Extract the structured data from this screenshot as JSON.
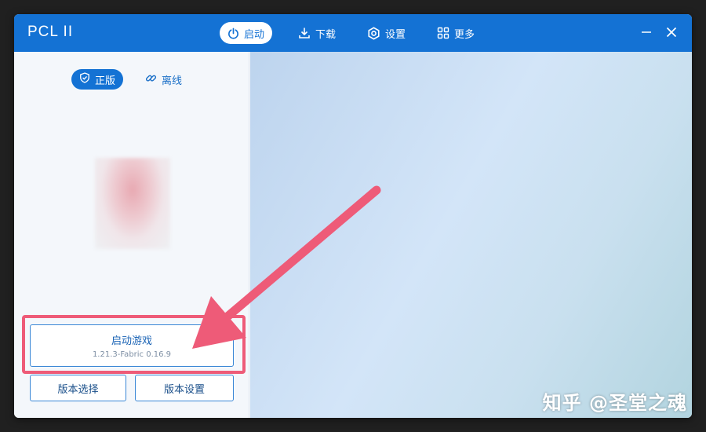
{
  "app": {
    "title": "PCL II"
  },
  "nav": {
    "tabs": [
      {
        "label": "启动",
        "icon": "power-icon",
        "active": true
      },
      {
        "label": "下载",
        "icon": "download-icon",
        "active": false
      },
      {
        "label": "设置",
        "icon": "gear-icon",
        "active": false
      },
      {
        "label": "更多",
        "icon": "grid-icon",
        "active": false
      }
    ]
  },
  "mode": {
    "official": "正版",
    "offline": "离线"
  },
  "launch": {
    "title": "启动游戏",
    "version": "1.21.3-Fabric 0.16.9"
  },
  "buttons": {
    "select_version": "版本选择",
    "version_settings": "版本设置"
  },
  "watermark": "知乎 @圣堂之魂",
  "colors": {
    "accent": "#1472d4",
    "highlight": "#ee5b78"
  }
}
